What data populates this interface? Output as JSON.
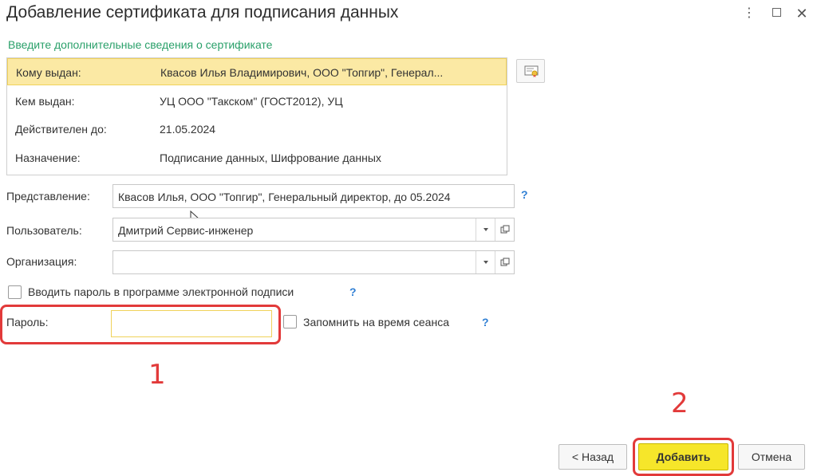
{
  "window": {
    "title": "Добавление сертификата для подписания данных",
    "more_glyph": "⋮",
    "maximize_glyph": "",
    "close_glyph": "✕"
  },
  "section_label": "Введите дополнительные сведения о сертификате",
  "certificate": {
    "rows": [
      {
        "key": "Кому выдан:",
        "value": "Квасов Илья Владимирович, ООО \"Топгир\", Генерал..."
      },
      {
        "key": "Кем выдан:",
        "value": "УЦ ООО \"Такском\" (ГОСТ2012), УЦ"
      },
      {
        "key": "Действителен до:",
        "value": "21.05.2024"
      },
      {
        "key": "Назначение:",
        "value": "Подписание данных, Шифрование данных"
      }
    ]
  },
  "fields": {
    "representation": {
      "label": "Представление:",
      "value": "Квасов Илья, ООО \"Топгир\", Генеральный директор, до 05.2024",
      "help": "?"
    },
    "user": {
      "label": "Пользователь:",
      "value": "Дмитрий Сервис-инженер"
    },
    "organization": {
      "label": "Организация:",
      "value": ""
    },
    "enter_password_in_app": {
      "label": "Вводить пароль в программе электронной подписи",
      "help": "?"
    },
    "password": {
      "label": "Пароль:",
      "value": ""
    },
    "remember": {
      "label": "Запомнить на время сеанса",
      "help": "?"
    }
  },
  "callouts": {
    "one": "1",
    "two": "2"
  },
  "buttons": {
    "back": "< Назад",
    "add": "Добавить",
    "cancel": "Отмена"
  },
  "colors": {
    "accent_green": "#2aa06a",
    "selection_yellow": "#fbe9a4",
    "primary_button": "#f6e62a",
    "callout_red": "#e23a3a",
    "help_blue": "#2f7fd4"
  }
}
